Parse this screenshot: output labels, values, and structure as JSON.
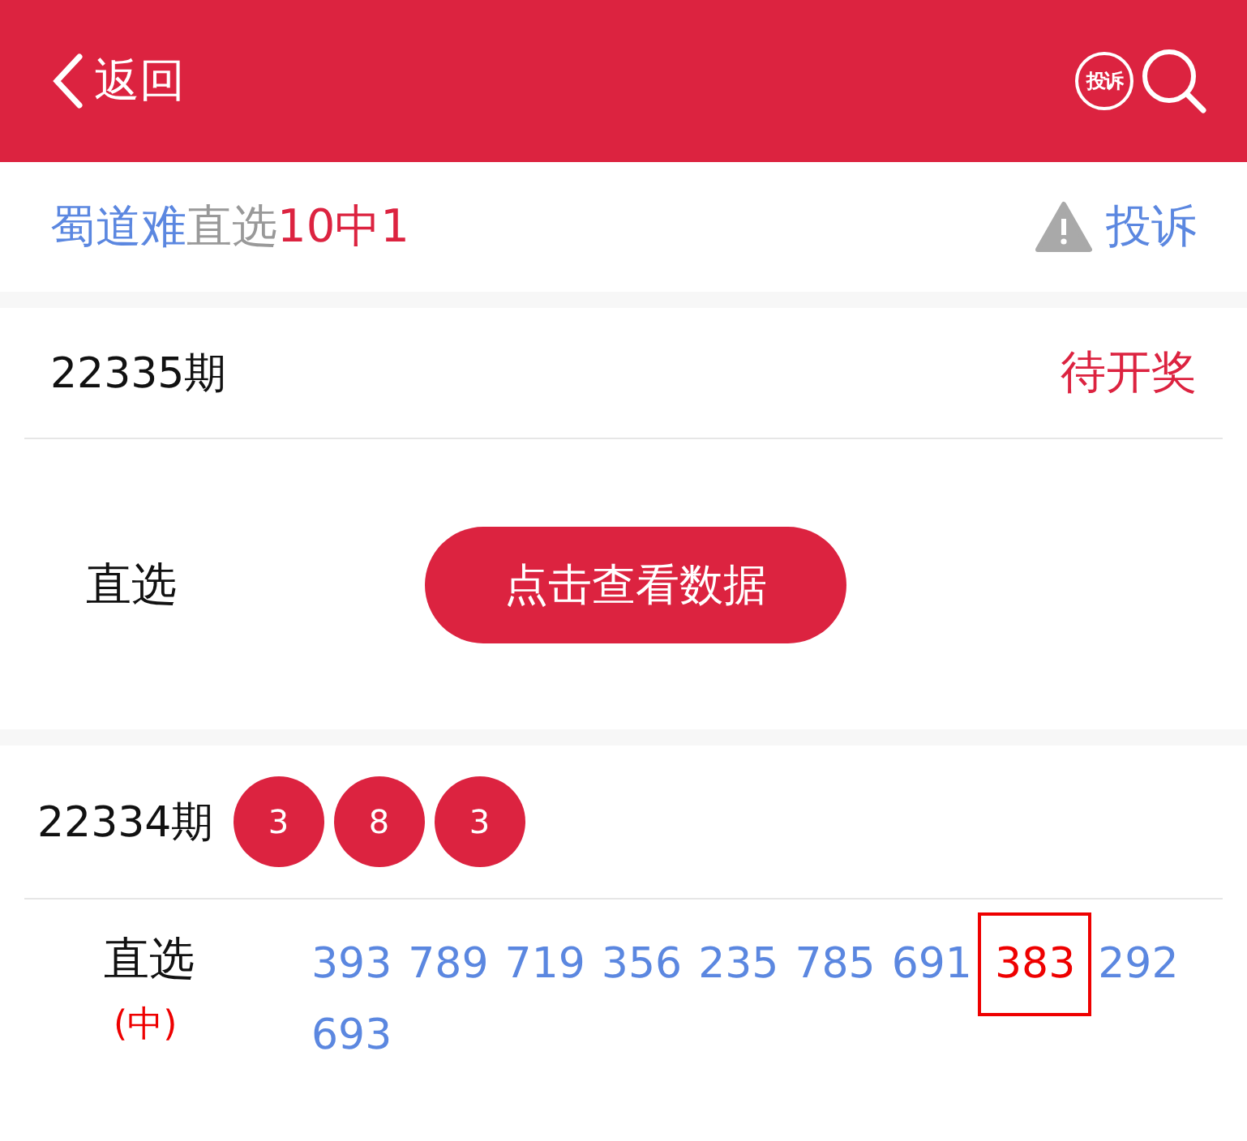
{
  "header": {
    "back_label": "返回",
    "complaint_badge": "投诉"
  },
  "title": {
    "name": "蜀道难",
    "type": "直选",
    "record": "10中1",
    "complaint": "投诉"
  },
  "current": {
    "period": "22335期",
    "status": "待开奖",
    "row_label": "直选",
    "button": "点击查看数据"
  },
  "previous": {
    "period": "22334期",
    "balls": [
      "3",
      "8",
      "3"
    ],
    "row_label": "直选",
    "result": "(中)",
    "numbers": [
      {
        "text": "393",
        "hit": false
      },
      {
        "text": "789",
        "hit": false
      },
      {
        "text": "719",
        "hit": false
      },
      {
        "text": "356",
        "hit": false
      },
      {
        "text": "235",
        "hit": false
      },
      {
        "text": "785",
        "hit": false
      },
      {
        "text": "691",
        "hit": false
      },
      {
        "text": "383",
        "hit": true
      },
      {
        "text": "292",
        "hit": false
      },
      {
        "text": "693",
        "hit": false
      }
    ]
  }
}
